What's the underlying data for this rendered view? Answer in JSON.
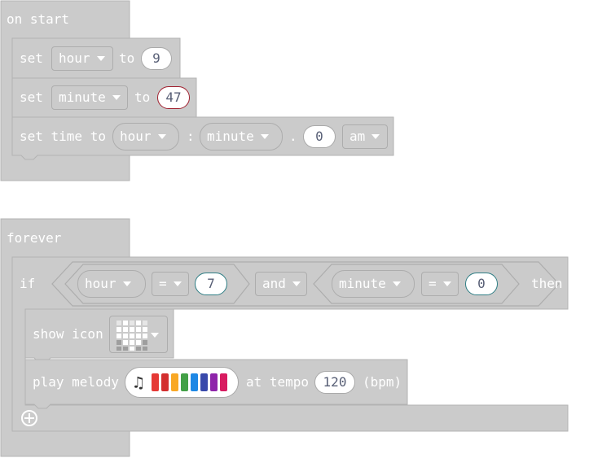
{
  "on_start": {
    "hat_label": "on start",
    "rows": [
      {
        "set_label": "set",
        "var": "hour",
        "to_label": "to",
        "value": "9"
      },
      {
        "set_label": "set",
        "var": "minute",
        "to_label": "to",
        "value": "47"
      }
    ],
    "set_time": {
      "label": "set time to",
      "hour": "hour",
      "colon": ":",
      "minute": "minute",
      "dot": ".",
      "seconds": "0",
      "ampm": "am"
    }
  },
  "forever": {
    "hat_label": "forever",
    "if": {
      "if_label": "if",
      "left": {
        "var": "hour",
        "op": "=",
        "value": "7"
      },
      "and_label": "and",
      "right": {
        "var": "minute",
        "op": "=",
        "value": "0"
      },
      "then_label": "then"
    },
    "show_icon": {
      "label": "show icon",
      "icon": "heart-led-icon"
    },
    "play_melody": {
      "label": "play melody",
      "at_tempo": "at tempo",
      "tempo": "120",
      "unit": "(bpm)",
      "colors": [
        "#e53935",
        "#d32f2f",
        "#f9a825",
        "#43a047",
        "#1e88e5",
        "#3949ab",
        "#8e24aa",
        "#d81b60"
      ]
    },
    "add_icon": "plus-circle-icon"
  },
  "colors": {
    "block": "#cbcbcb",
    "border": "#b3b3b3",
    "selected_outline": "#a0202f",
    "teal_outline": "#2d7d84"
  }
}
